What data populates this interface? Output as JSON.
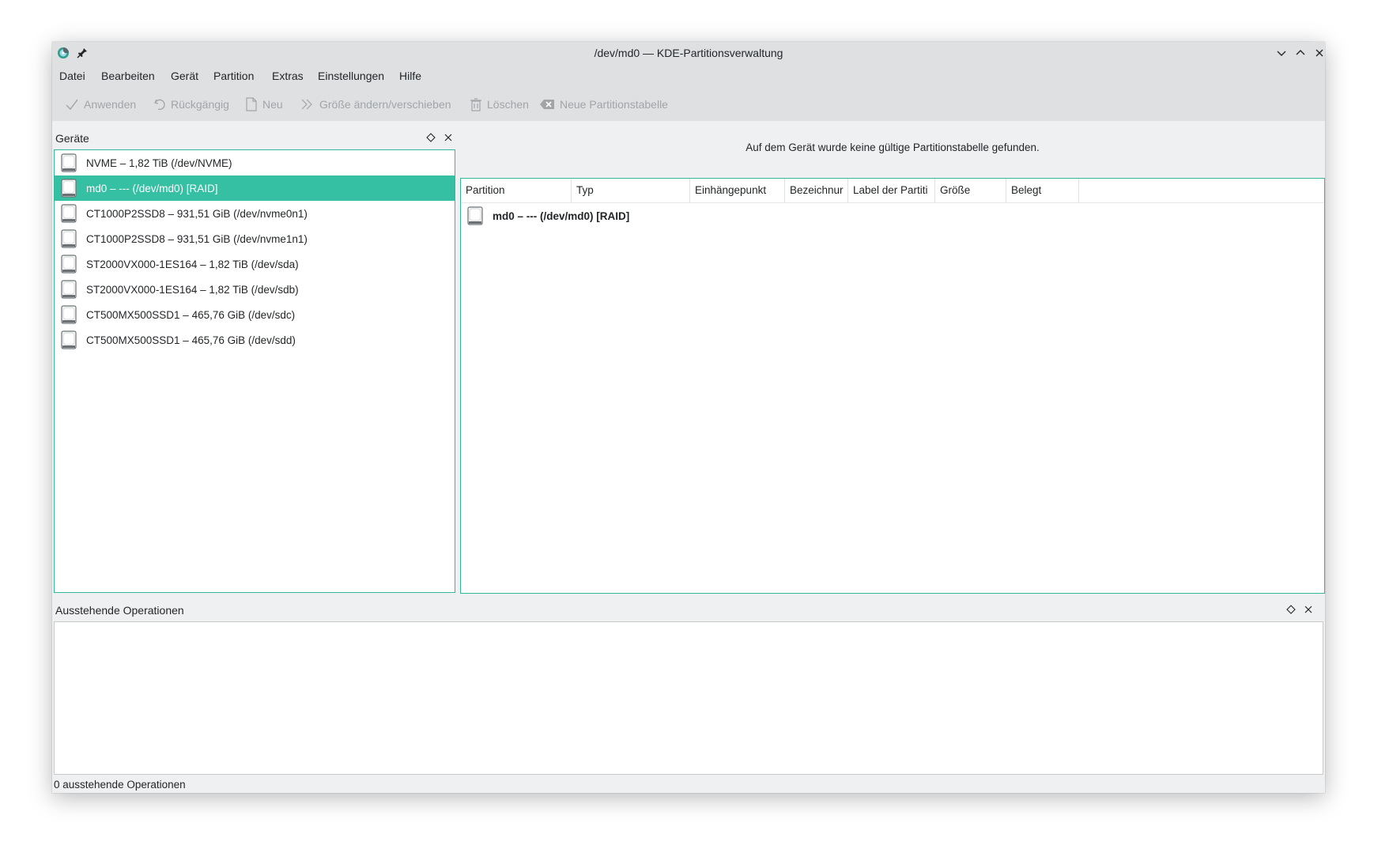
{
  "window": {
    "title": "/dev/md0 — KDE-Partitionsverwaltung"
  },
  "menu": [
    "Datei",
    "Bearbeiten",
    "Gerät",
    "Partition",
    "Extras",
    "Einstellungen",
    "Hilfe"
  ],
  "toolbar": {
    "apply": "Anwenden",
    "undo": "Rückgängig",
    "new": "Neu",
    "resize": "Größe ändern/verschieben",
    "delete": "Löschen",
    "new_table": "Neue Partitionstabelle"
  },
  "devices_pane": {
    "title": "Geräte",
    "items": [
      {
        "label": "NVME – 1,82 TiB (/dev/NVME)"
      },
      {
        "label": "md0 – --- (/dev/md0) [RAID]"
      },
      {
        "label": "CT1000P2SSD8 – 931,51 GiB (/dev/nvme0n1)"
      },
      {
        "label": "CT1000P2SSD8 – 931,51 GiB (/dev/nvme1n1)"
      },
      {
        "label": "ST2000VX000-1ES164 – 1,82 TiB (/dev/sda)"
      },
      {
        "label": "ST2000VX000-1ES164 – 1,82 TiB (/dev/sdb)"
      },
      {
        "label": "CT500MX500SSD1 – 465,76 GiB (/dev/sdc)"
      },
      {
        "label": "CT500MX500SSD1 – 465,76 GiB (/dev/sdd)"
      }
    ],
    "selected_index": 1
  },
  "main": {
    "message": "Auf dem Gerät wurde keine gültige Partitionstabelle gefunden.",
    "columns": [
      "Partition",
      "Typ",
      "Einhängepunkt",
      "Bezeichnur",
      "Label der Partiti",
      "Größe",
      "Belegt"
    ],
    "rows": [
      {
        "label": "md0 – --- (/dev/md0) [RAID]"
      }
    ]
  },
  "operations_pane": {
    "title": "Ausstehende Operationen"
  },
  "status": "0 ausstehende Operationen",
  "colors": {
    "selection": "#35bfa3",
    "focus_border": "#34b89b",
    "chrome": "#dee0e2"
  }
}
